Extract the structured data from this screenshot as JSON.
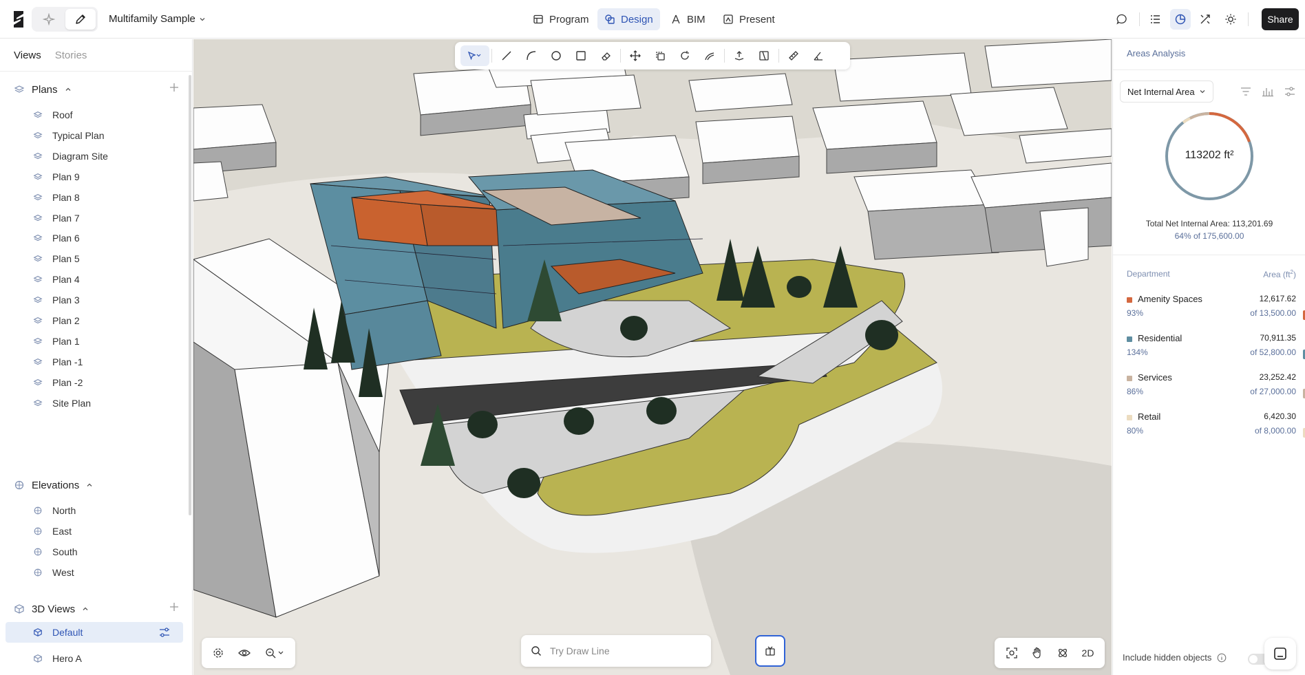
{
  "header": {
    "project_title": "Multifamily Sample",
    "tabs": [
      {
        "label": "Program",
        "icon": "table-icon"
      },
      {
        "label": "Design",
        "icon": "design-icon"
      },
      {
        "label": "BIM",
        "icon": "bim-icon"
      },
      {
        "label": "Present",
        "icon": "present-icon"
      }
    ],
    "active_tab": "Design",
    "share_label": "Share"
  },
  "sidebar": {
    "tabs": [
      "Views",
      "Stories"
    ],
    "active_tab": "Views",
    "plans": {
      "title": "Plans",
      "items": [
        "Roof",
        "Typical Plan",
        "Diagram Site",
        "Plan 9",
        "Plan 8",
        "Plan 7",
        "Plan 6",
        "Plan 5",
        "Plan 4",
        "Plan 3",
        "Plan 2",
        "Plan 1",
        "Plan -1",
        "Plan -2",
        "Site Plan"
      ]
    },
    "elevations": {
      "title": "Elevations",
      "items": [
        "North",
        "East",
        "South",
        "West"
      ]
    },
    "views3d": {
      "title": "3D Views",
      "items": [
        "Default",
        "Hero A"
      ],
      "selected": "Default"
    }
  },
  "viewport": {
    "command_placeholder": "Try Draw Line",
    "view_mode_label": "2D"
  },
  "analysis": {
    "title": "Areas Analysis",
    "metric": "Net Internal Area",
    "donut_label": "113202 ft²",
    "total_line": "Total Net Internal Area: 113,201.69",
    "pct_line": "64% of 175,600.00",
    "col_department": "Department",
    "col_area": "Area (ft",
    "col_area_sup": "2",
    "col_area_close": ")",
    "departments": [
      {
        "name": "Amenity Spaces",
        "pct": "93%",
        "value": "12,617.62",
        "target": "of 13,500.00",
        "color": "#d4683f"
      },
      {
        "name": "Residential",
        "pct": "134%",
        "value": "70,911.35",
        "target": "of 52,800.00",
        "color": "#5f8ea1"
      },
      {
        "name": "Services",
        "pct": "86%",
        "value": "23,252.42",
        "target": "of 27,000.00",
        "color": "#c9b3a0"
      },
      {
        "name": "Retail",
        "pct": "80%",
        "value": "6,420.30",
        "target": "of 8,000.00",
        "color": "#ecdcc0"
      }
    ],
    "include_hidden_label": "Include hidden objects"
  },
  "colors": {
    "accent": "#2f55b4",
    "donut_main": "#7e98a7",
    "donut_amenity": "#d4683f"
  }
}
